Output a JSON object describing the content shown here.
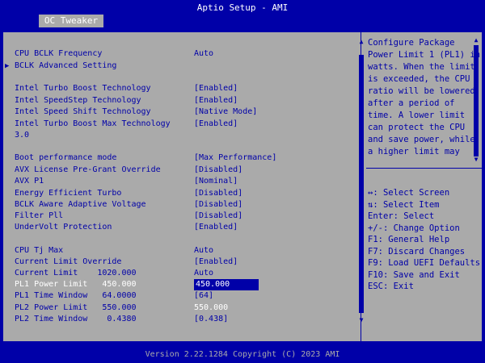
{
  "title": "Aptio Setup - AMI",
  "tab": "OC Tweaker",
  "rows": [
    {
      "label": "CPU BCLK Frequency",
      "value": "Auto"
    },
    {
      "label": "BCLK Advanced Setting",
      "value": ""
    },
    {
      "label": "Intel Turbo Boost Technology",
      "value": "[Enabled]"
    },
    {
      "label": "Intel SpeedStep Technology",
      "value": "[Enabled]"
    },
    {
      "label": "Intel Speed Shift Technology",
      "value": "[Native Mode]"
    },
    {
      "label": "Intel Turbo Boost Max Technology",
      "value": "[Enabled]"
    },
    {
      "label": "3.0",
      "value": ""
    },
    {
      "label": "Boot performance mode",
      "value": "[Max Performance]"
    },
    {
      "label": "AVX License Pre-Grant Override",
      "value": "[Disabled]"
    },
    {
      "label": "AVX P1",
      "value": "[Nominal]"
    },
    {
      "label": "Energy Efficient Turbo",
      "value": "[Disabled]"
    },
    {
      "label": "BCLK Aware Adaptive Voltage",
      "value": "[Disabled]"
    },
    {
      "label": "Filter Pll",
      "value": "[Disabled]"
    },
    {
      "label": "UnderVolt Protection",
      "value": "[Enabled]"
    },
    {
      "label": "CPU Tj Max",
      "value": "Auto"
    },
    {
      "label": "Current Limit Override",
      "value": "[Enabled]"
    },
    {
      "label": "Current Limit    1020.000",
      "value": "Auto"
    },
    {
      "label": "PL1 Power Limit   450.000",
      "value": "450.000"
    },
    {
      "label": "PL1 Time Window   64.0000",
      "value": "[64]"
    },
    {
      "label": "PL2 Power Limit   550.000",
      "value": "550.000"
    },
    {
      "label": "PL2 Time Window    0.4380",
      "value": "[0.438]"
    }
  ],
  "help_text": "Configure Package Power Limit 1 (PL1) in watts. When the limit is exceeded, the CPU ratio will be lowered after a period of time. A lower limit can protect the CPU and save power, while a higher limit may",
  "keys": [
    "↔: Select Screen",
    "⇅: Select Item",
    "Enter: Select",
    "+/-: Change Option",
    "F1: General Help",
    "F7: Discard Changes",
    "F9: Load UEFI Defaults",
    "F10: Save and Exit",
    "ESC: Exit"
  ],
  "footer": "Version 2.22.1284 Copyright (C) 2023 AMI"
}
